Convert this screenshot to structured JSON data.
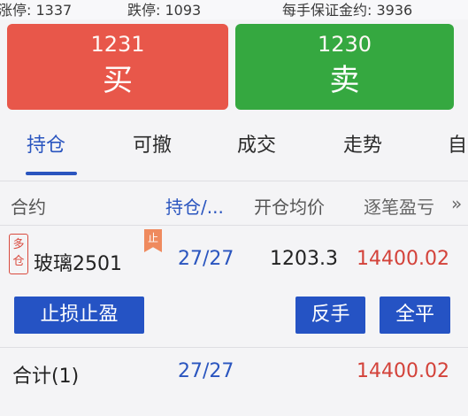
{
  "top_info": {
    "limit_up": "涨停: 1337",
    "limit_down": "跌停: 1093",
    "margin": "每手保证金约: 3936"
  },
  "buy": {
    "price": "1231",
    "label": "买"
  },
  "sell": {
    "price": "1230",
    "label": "卖"
  },
  "tabs": [
    "持仓",
    "可撤",
    "成交",
    "走势",
    "自"
  ],
  "columns": [
    "合约",
    "持仓/...",
    "开仓均价",
    "逐笔盈亏",
    "»"
  ],
  "position": {
    "badge_top": "多",
    "badge_bottom": "仓",
    "stop_flag": "止",
    "contract": "玻璃2501",
    "quantity": "27/27",
    "avg_price": "1203.3",
    "pnl": "14400.02"
  },
  "actions": {
    "stop_loss_profit": "止损止盈",
    "reverse": "反手",
    "close_all": "全平"
  },
  "total": {
    "label": "合计(1)",
    "quantity": "27/27",
    "pnl": "14400.02"
  },
  "colors": {
    "buy": "#e8574a",
    "sell": "#35a840",
    "accent_blue": "#2a55bf",
    "button_blue": "#2553c4",
    "profit_red": "#d3423a"
  }
}
